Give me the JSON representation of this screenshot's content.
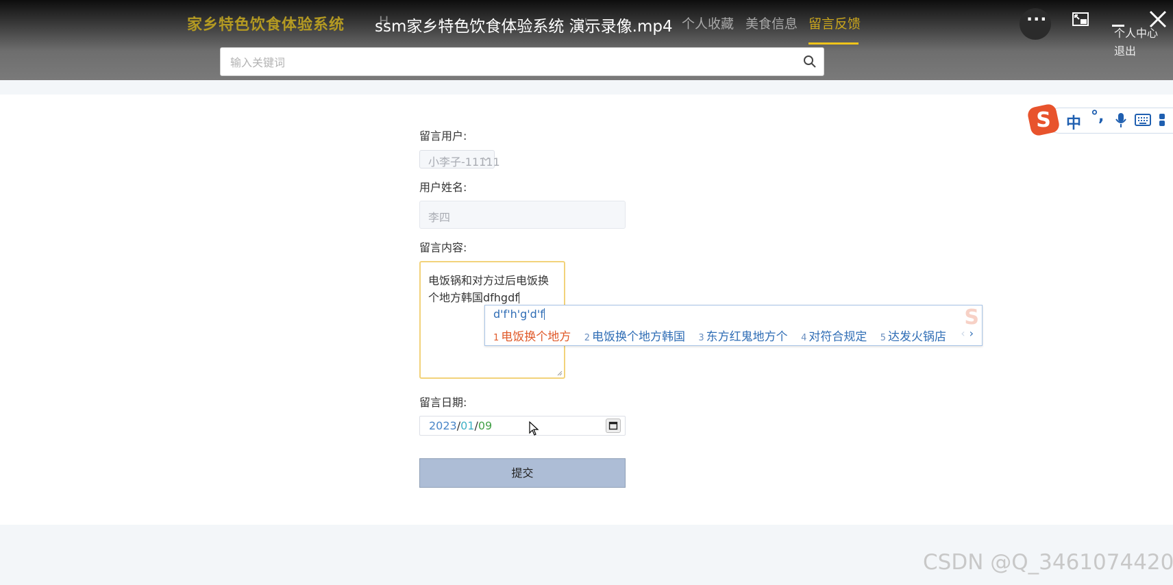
{
  "header": {
    "brand": "家乡特色饮食体验系统",
    "video_title": "ssm家乡特色饮食体验系统 演示录像.mp4",
    "nav_ghost": "H",
    "nav_ghost_partial": "八",
    "nav": [
      {
        "label": "个人收藏",
        "active": false
      },
      {
        "label": "美食信息",
        "active": false
      },
      {
        "label": "留言反馈",
        "active": true
      }
    ],
    "more_label": "···",
    "user_center": "个人中心",
    "logout": "退出",
    "search_placeholder": "输入关键词",
    "search_value": ""
  },
  "form": {
    "user_label": "留言用户:",
    "user_value": "小李子-11111",
    "name_label": "用户姓名:",
    "name_value": "李四",
    "content_label": "留言内容:",
    "content_value": "电饭锅和对方过后电饭换个地方韩国dfhgdf",
    "date_label": "留言日期:",
    "date_year": "2023",
    "date_month": "01",
    "date_day": "09",
    "date_sep": "/",
    "submit_label": "提交"
  },
  "ime": {
    "pinyin": "d'f'h'g'd'f",
    "candidates": [
      {
        "n": "1",
        "text": "电饭换个地方"
      },
      {
        "n": "2",
        "text": "电饭换个地方韩国"
      },
      {
        "n": "3",
        "text": "东方红鬼地方个"
      },
      {
        "n": "4",
        "text": "对符合规定"
      },
      {
        "n": "5",
        "text": "达发火锅店"
      }
    ],
    "prev": "‹",
    "next": "›",
    "toolbar_lang": "中",
    "toolbar_punct": "°,"
  },
  "watermark": "CSDN @Q_3461074420",
  "colors": {
    "brand": "#b49a22",
    "nav_active": "#c9a51d",
    "underline": "#f0c419",
    "submit_bg": "#adbdd6",
    "ime_blue": "#2f6db5",
    "ime_first": "#e05a2a",
    "sogou_red": "#e8532c"
  }
}
